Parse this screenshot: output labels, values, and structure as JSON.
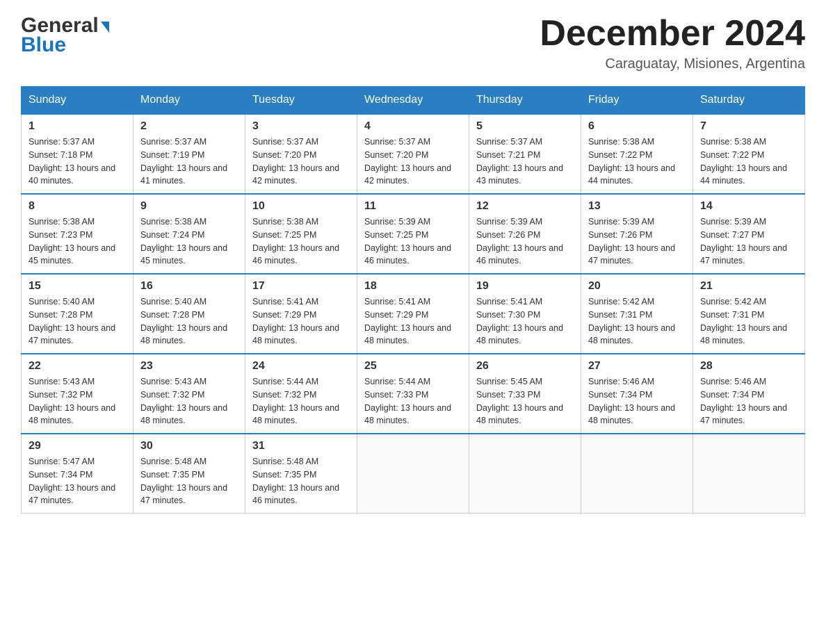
{
  "header": {
    "logo_general": "General",
    "logo_blue": "Blue",
    "month_title": "December 2024",
    "location": "Caraguatay, Misiones, Argentina"
  },
  "days_of_week": [
    "Sunday",
    "Monday",
    "Tuesday",
    "Wednesday",
    "Thursday",
    "Friday",
    "Saturday"
  ],
  "weeks": [
    [
      {
        "day": "1",
        "sunrise": "5:37 AM",
        "sunset": "7:18 PM",
        "daylight": "13 hours and 40 minutes."
      },
      {
        "day": "2",
        "sunrise": "5:37 AM",
        "sunset": "7:19 PM",
        "daylight": "13 hours and 41 minutes."
      },
      {
        "day": "3",
        "sunrise": "5:37 AM",
        "sunset": "7:20 PM",
        "daylight": "13 hours and 42 minutes."
      },
      {
        "day": "4",
        "sunrise": "5:37 AM",
        "sunset": "7:20 PM",
        "daylight": "13 hours and 42 minutes."
      },
      {
        "day": "5",
        "sunrise": "5:37 AM",
        "sunset": "7:21 PM",
        "daylight": "13 hours and 43 minutes."
      },
      {
        "day": "6",
        "sunrise": "5:38 AM",
        "sunset": "7:22 PM",
        "daylight": "13 hours and 44 minutes."
      },
      {
        "day": "7",
        "sunrise": "5:38 AM",
        "sunset": "7:22 PM",
        "daylight": "13 hours and 44 minutes."
      }
    ],
    [
      {
        "day": "8",
        "sunrise": "5:38 AM",
        "sunset": "7:23 PM",
        "daylight": "13 hours and 45 minutes."
      },
      {
        "day": "9",
        "sunrise": "5:38 AM",
        "sunset": "7:24 PM",
        "daylight": "13 hours and 45 minutes."
      },
      {
        "day": "10",
        "sunrise": "5:38 AM",
        "sunset": "7:25 PM",
        "daylight": "13 hours and 46 minutes."
      },
      {
        "day": "11",
        "sunrise": "5:39 AM",
        "sunset": "7:25 PM",
        "daylight": "13 hours and 46 minutes."
      },
      {
        "day": "12",
        "sunrise": "5:39 AM",
        "sunset": "7:26 PM",
        "daylight": "13 hours and 46 minutes."
      },
      {
        "day": "13",
        "sunrise": "5:39 AM",
        "sunset": "7:26 PM",
        "daylight": "13 hours and 47 minutes."
      },
      {
        "day": "14",
        "sunrise": "5:39 AM",
        "sunset": "7:27 PM",
        "daylight": "13 hours and 47 minutes."
      }
    ],
    [
      {
        "day": "15",
        "sunrise": "5:40 AM",
        "sunset": "7:28 PM",
        "daylight": "13 hours and 47 minutes."
      },
      {
        "day": "16",
        "sunrise": "5:40 AM",
        "sunset": "7:28 PM",
        "daylight": "13 hours and 48 minutes."
      },
      {
        "day": "17",
        "sunrise": "5:41 AM",
        "sunset": "7:29 PM",
        "daylight": "13 hours and 48 minutes."
      },
      {
        "day": "18",
        "sunrise": "5:41 AM",
        "sunset": "7:29 PM",
        "daylight": "13 hours and 48 minutes."
      },
      {
        "day": "19",
        "sunrise": "5:41 AM",
        "sunset": "7:30 PM",
        "daylight": "13 hours and 48 minutes."
      },
      {
        "day": "20",
        "sunrise": "5:42 AM",
        "sunset": "7:31 PM",
        "daylight": "13 hours and 48 minutes."
      },
      {
        "day": "21",
        "sunrise": "5:42 AM",
        "sunset": "7:31 PM",
        "daylight": "13 hours and 48 minutes."
      }
    ],
    [
      {
        "day": "22",
        "sunrise": "5:43 AM",
        "sunset": "7:32 PM",
        "daylight": "13 hours and 48 minutes."
      },
      {
        "day": "23",
        "sunrise": "5:43 AM",
        "sunset": "7:32 PM",
        "daylight": "13 hours and 48 minutes."
      },
      {
        "day": "24",
        "sunrise": "5:44 AM",
        "sunset": "7:32 PM",
        "daylight": "13 hours and 48 minutes."
      },
      {
        "day": "25",
        "sunrise": "5:44 AM",
        "sunset": "7:33 PM",
        "daylight": "13 hours and 48 minutes."
      },
      {
        "day": "26",
        "sunrise": "5:45 AM",
        "sunset": "7:33 PM",
        "daylight": "13 hours and 48 minutes."
      },
      {
        "day": "27",
        "sunrise": "5:46 AM",
        "sunset": "7:34 PM",
        "daylight": "13 hours and 48 minutes."
      },
      {
        "day": "28",
        "sunrise": "5:46 AM",
        "sunset": "7:34 PM",
        "daylight": "13 hours and 47 minutes."
      }
    ],
    [
      {
        "day": "29",
        "sunrise": "5:47 AM",
        "sunset": "7:34 PM",
        "daylight": "13 hours and 47 minutes."
      },
      {
        "day": "30",
        "sunrise": "5:48 AM",
        "sunset": "7:35 PM",
        "daylight": "13 hours and 47 minutes."
      },
      {
        "day": "31",
        "sunrise": "5:48 AM",
        "sunset": "7:35 PM",
        "daylight": "13 hours and 46 minutes."
      },
      null,
      null,
      null,
      null
    ]
  ],
  "labels": {
    "sunrise_prefix": "Sunrise: ",
    "sunset_prefix": "Sunset: ",
    "daylight_prefix": "Daylight: "
  }
}
